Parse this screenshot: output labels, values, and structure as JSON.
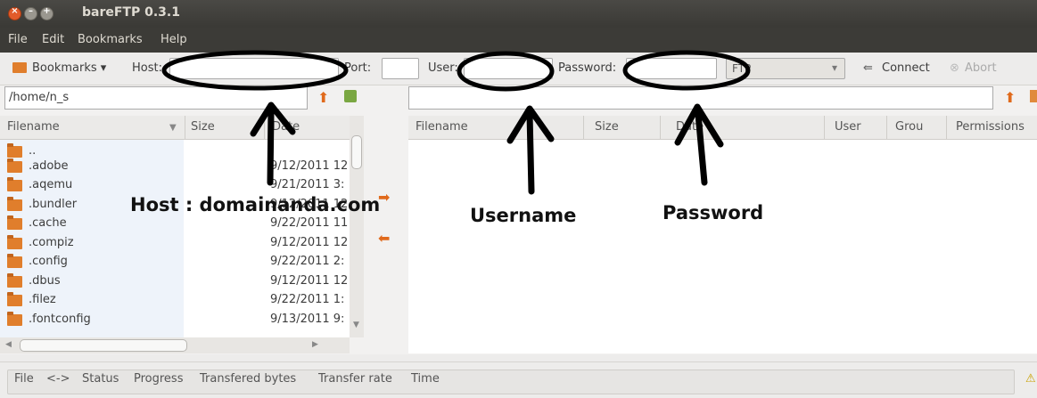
{
  "window": {
    "title": "bareFTP 0.3.1"
  },
  "menu": {
    "file": "File",
    "edit": "Edit",
    "bookmarks": "Bookmarks",
    "help": "Help"
  },
  "toolbar": {
    "bookmarks_label": "Bookmarks ▾",
    "host_label": "Host:",
    "port_label": "Port:",
    "user_label": "User:",
    "password_label": "Password:",
    "protocol_value": "FTP",
    "connect_label": "Connect",
    "abort_label": "Abort"
  },
  "local": {
    "path": "/home/n_s",
    "columns": {
      "filename": "Filename",
      "size": "Size",
      "date": "Date"
    },
    "files": [
      {
        "name": "..",
        "date": ""
      },
      {
        "name": ".adobe",
        "date": "9/12/2011 12"
      },
      {
        "name": ".aqemu",
        "date": "9/21/2011 3:"
      },
      {
        "name": ".bundler",
        "date": "9/12/2011 12"
      },
      {
        "name": ".cache",
        "date": "9/22/2011 11"
      },
      {
        "name": ".compiz",
        "date": "9/12/2011 12"
      },
      {
        "name": ".config",
        "date": "9/22/2011 2:"
      },
      {
        "name": ".dbus",
        "date": "9/12/2011 12"
      },
      {
        "name": ".filez",
        "date": "9/22/2011 1:"
      },
      {
        "name": ".fontconfig",
        "date": "9/13/2011 9:"
      }
    ]
  },
  "remote": {
    "path": "",
    "columns": {
      "filename": "Filename",
      "size": "Size",
      "date": "Date",
      "user": "User",
      "group": "Grou",
      "permissions": "Permissions"
    }
  },
  "status": {
    "columns": [
      "File",
      "<->",
      "Status",
      "Progress",
      "Transfered bytes",
      "Transfer rate",
      "Time"
    ]
  },
  "annotations": {
    "host": "Host : domainanda.com",
    "username": "Username",
    "password": "Password"
  }
}
